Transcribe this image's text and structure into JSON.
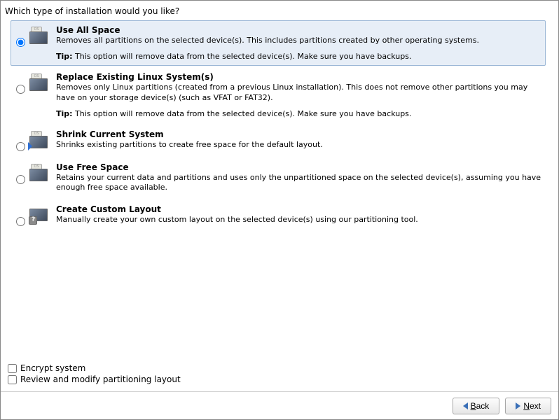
{
  "header": {
    "question": "Which type of installation would you like?"
  },
  "options": [
    {
      "id": "use-all-space",
      "title": "Use All Space",
      "desc": "Removes all partitions on the selected device(s).  This includes partitions created by other operating systems.",
      "tip_label": "Tip:",
      "tip": " This option will remove data from the selected device(s).  Make sure you have backups.",
      "selected": true
    },
    {
      "id": "replace-existing",
      "title": "Replace Existing Linux System(s)",
      "desc": "Removes only Linux partitions (created from a previous Linux installation).  This does not remove other partitions you may have on your storage device(s) (such as VFAT or FAT32).",
      "tip_label": "Tip:",
      "tip": " This option will remove data from the selected device(s).  Make sure you have backups.",
      "selected": false
    },
    {
      "id": "shrink-current",
      "title": "Shrink Current System",
      "desc": "Shrinks existing partitions to create free space for the default layout.",
      "selected": false
    },
    {
      "id": "use-free-space",
      "title": "Use Free Space",
      "desc": "Retains your current data and partitions and uses only the unpartitioned space on the selected device(s), assuming you have enough free space available.",
      "selected": false
    },
    {
      "id": "create-custom",
      "title": "Create Custom Layout",
      "desc": "Manually create your own custom layout on the selected device(s) using our partitioning tool.",
      "selected": false
    }
  ],
  "checkboxes": {
    "encrypt_label": "Encrypt system",
    "review_label": "Review and modify partitioning layout"
  },
  "footer": {
    "back_label": "Back",
    "next_label": "Next"
  }
}
